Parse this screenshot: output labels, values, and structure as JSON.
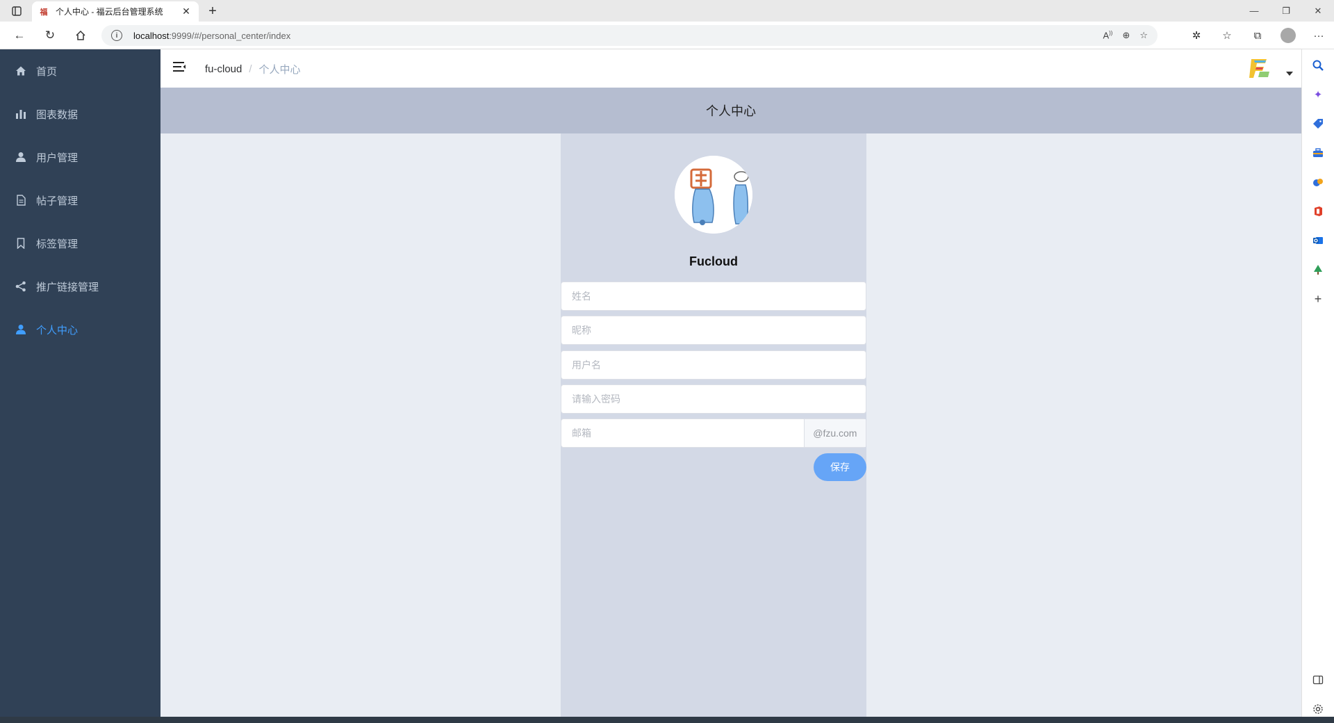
{
  "browser": {
    "tab_title": "个人中心 - 福云后台管理系统",
    "url_host": "localhost",
    "url_path": ":9999/#/personal_center/index"
  },
  "sidebar": {
    "items": [
      {
        "label": "首页",
        "icon": "home-icon"
      },
      {
        "label": "图表数据",
        "icon": "bar-chart-icon"
      },
      {
        "label": "用户管理",
        "icon": "user-icon"
      },
      {
        "label": "帖子管理",
        "icon": "document-icon"
      },
      {
        "label": "标签管理",
        "icon": "bookmark-icon"
      },
      {
        "label": "推广链接管理",
        "icon": "share-icon"
      },
      {
        "label": "个人中心",
        "icon": "user-icon",
        "active": true
      }
    ]
  },
  "navbar": {
    "breadcrumb_root": "fu-cloud",
    "breadcrumb_separator": "/",
    "breadcrumb_current": "个人中心"
  },
  "page": {
    "title": "个人中心",
    "username": "Fucloud"
  },
  "form": {
    "name_placeholder": "姓名",
    "nickname_placeholder": "昵称",
    "username_placeholder": "用户名",
    "password_placeholder": "请输入密码",
    "email_placeholder": "邮箱",
    "email_suffix": "@fzu.com",
    "save_label": "保存"
  },
  "colors": {
    "sidebar_bg": "#304156",
    "sidebar_text": "#bfcbd9",
    "active": "#409eff",
    "header_bg": "#b5bdd0",
    "panel_bg": "#d3d9e6",
    "button": "#66a5f7"
  }
}
